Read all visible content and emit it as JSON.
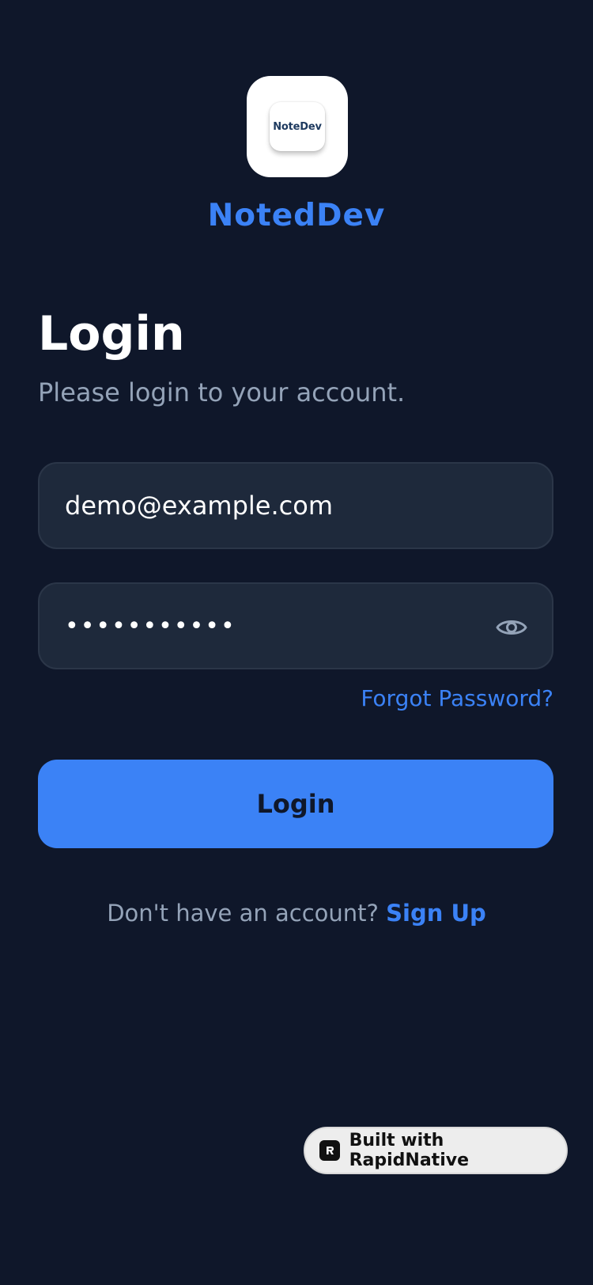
{
  "app": {
    "logo_text": "NoteDev",
    "brand_name": "NotedDev"
  },
  "login": {
    "title": "Login",
    "subtitle": "Please login to your account.",
    "email_value": "demo@example.com",
    "password_masked": "•••••••••••",
    "forgot_label": "Forgot Password?",
    "login_button_label": "Login",
    "signup_prompt": "Don't have an account?",
    "signup_link": "Sign Up"
  },
  "badge": {
    "label": "Built with RapidNative"
  },
  "icons": {
    "password_toggle": "eye-icon",
    "badge_logo": "rapidnative-logo-icon"
  },
  "colors": {
    "background": "#0f172a",
    "accent": "#3b82f6",
    "field_background": "#1e293b",
    "muted_text": "#94a3b8"
  }
}
